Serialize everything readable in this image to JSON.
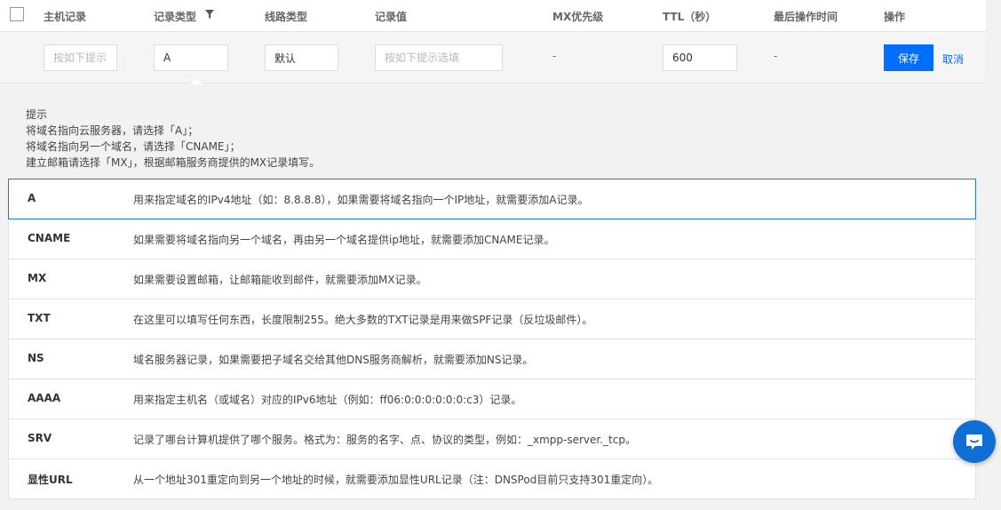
{
  "header": {
    "col_host": "主机记录",
    "col_type": "记录类型",
    "col_line": "线路类型",
    "col_value": "记录值",
    "col_mx": "MX优先级",
    "col_ttl": "TTL（秒）",
    "col_time": "最后操作时间",
    "col_action": "操作"
  },
  "edit_row": {
    "host_placeholder": "按如下提示",
    "type_value": "A",
    "line_value": "默认",
    "value_placeholder": "按如下提示选填",
    "mx_value": "-",
    "ttl_value": "600",
    "time_value": "-",
    "save_label": "保存",
    "cancel_label": "取消"
  },
  "tips": {
    "title": "提示",
    "lines": [
      "将域名指向云服务器，请选择「A」；",
      "将域名指向另一个域名，请选择「CNAME」；",
      "建立邮箱请选择「MX」，根据邮箱服务商提供的MX记录填写。"
    ]
  },
  "record_types": [
    {
      "name": "A",
      "desc": "用来指定域名的IPv4地址（如：8.8.8.8），如果需要将域名指向一个IP地址，就需要添加A记录。"
    },
    {
      "name": "CNAME",
      "desc": "如果需要将域名指向另一个域名，再由另一个域名提供ip地址，就需要添加CNAME记录。"
    },
    {
      "name": "MX",
      "desc": "如果需要设置邮箱，让邮箱能收到邮件，就需要添加MX记录。"
    },
    {
      "name": "TXT",
      "desc": "在这里可以填写任何东西，长度限制255。绝大多数的TXT记录是用来做SPF记录（反垃圾邮件）。"
    },
    {
      "name": "NS",
      "desc": "域名服务器记录，如果需要把子域名交给其他DNS服务商解析，就需要添加NS记录。"
    },
    {
      "name": "AAAA",
      "desc": "用来指定主机名（或域名）对应的IPv6地址（例如：ff06:0:0:0:0:0:0:c3）记录。"
    },
    {
      "name": "SRV",
      "desc": "记录了哪台计算机提供了哪个服务。格式为：服务的名字、点、协议的类型，例如：_xmpp-server._tcp。"
    },
    {
      "name": "显性URL",
      "desc": "从一个地址301重定向到另一个地址的时候，就需要添加显性URL记录（注：DNSPod目前只支持301重定向）。"
    }
  ],
  "colors": {
    "primary": "#006eff",
    "selected_border": "#2d74c6",
    "chat_bg": "#0f6fd6"
  },
  "icons": {
    "filter": "filter-icon",
    "chat": "chat-icon"
  }
}
